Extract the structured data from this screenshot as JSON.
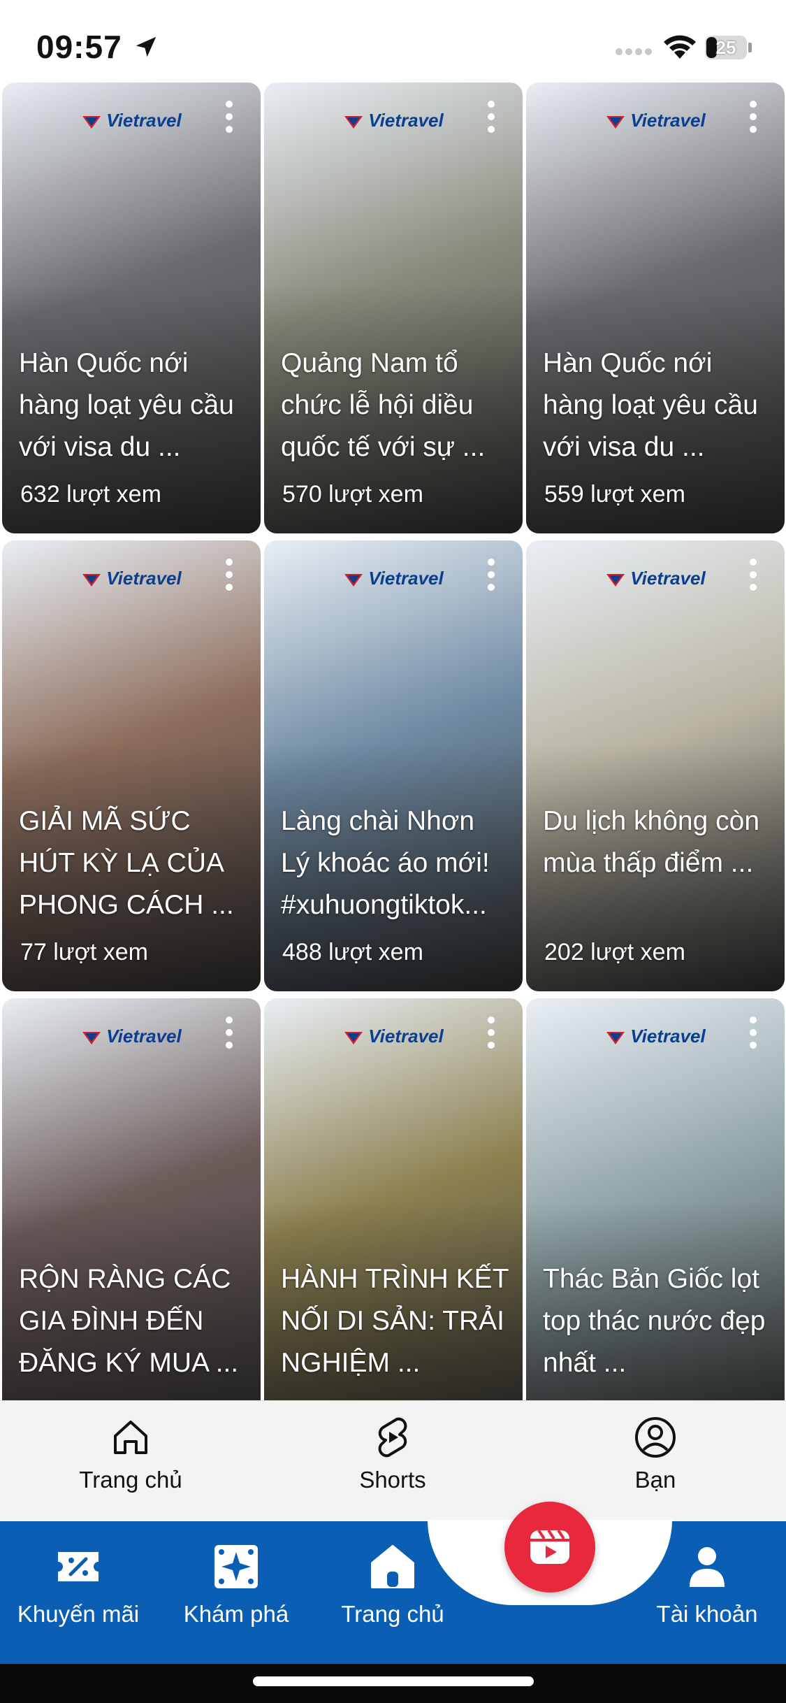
{
  "status_bar": {
    "time": "09:57",
    "battery": "25"
  },
  "brand_name": "Vietravel",
  "videos": [
    {
      "title": "Hàn Quốc nới hàng loạt yêu cầu với visa du ...",
      "views": "632 lượt xem",
      "bg": "#6d6a6f"
    },
    {
      "title": "Quảng Nam tổ chức lễ hội diều quốc tế với sự ...",
      "views": "570 lượt xem",
      "bg": "#8a8a7c"
    },
    {
      "title": "Hàn Quốc nới hàng loạt yêu cầu với visa du ...",
      "views": "559 lượt xem",
      "bg": "#6d6a6f"
    },
    {
      "title": "GIẢI MÃ SỨC HÚT KỲ LẠ CỦA PHONG CÁCH ...",
      "views": "77 lượt xem",
      "bg": "#8d6d5c"
    },
    {
      "title": "Làng chài Nhơn Lý khoác áo mới! #xuhuongtiktok...",
      "views": "488 lượt xem",
      "bg": "#6f8aa3"
    },
    {
      "title": "Du lịch không còn mùa thấp điểm ...",
      "views": "202 lượt xem",
      "bg": "#b9b4a3"
    },
    {
      "title": "RỘN RÀNG CÁC GIA ĐÌNH ĐẾN ĐĂNG KÝ MUA ...",
      "views": "",
      "bg": "#6a5a58"
    },
    {
      "title": "HÀNH TRÌNH KẾT NỐI DI SẢN: TRẢI NGHIỆM ...",
      "views": "",
      "bg": "#8d8150"
    },
    {
      "title": "Thác Bản Giốc lọt top thác nước đẹp nhất ...",
      "views": "",
      "bg": "#8fa2a5"
    }
  ],
  "shorts_nav": {
    "home": "Trang chủ",
    "shorts": "Shorts",
    "you": "Bạn"
  },
  "app_nav": {
    "promotions": "Khuyến mãi",
    "explore": "Khám phá",
    "home": "Trang chủ",
    "account": "Tài khoản"
  },
  "colors": {
    "nav_blue": "#0a5fb4",
    "fab_red": "#e8283c"
  }
}
